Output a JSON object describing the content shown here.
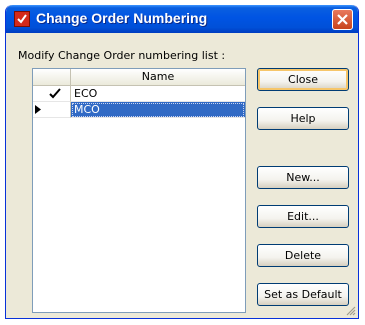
{
  "window": {
    "title": "Change Order Numbering"
  },
  "prompt_label": "Modify Change Order numbering list :",
  "list": {
    "column_header": "Name",
    "rows": [
      {
        "name": "ECO",
        "is_default": true,
        "selected": false
      },
      {
        "name": "MCO",
        "is_default": false,
        "selected": true
      }
    ]
  },
  "buttons": {
    "close": "Close",
    "help": "Help",
    "new": "New...",
    "edit": "Edit...",
    "delete": "Delete",
    "set_default": "Set as Default"
  },
  "colors": {
    "title_bar": "#0054e3",
    "selection": "#316ac5",
    "dialog_bg": "#ece9d8"
  }
}
